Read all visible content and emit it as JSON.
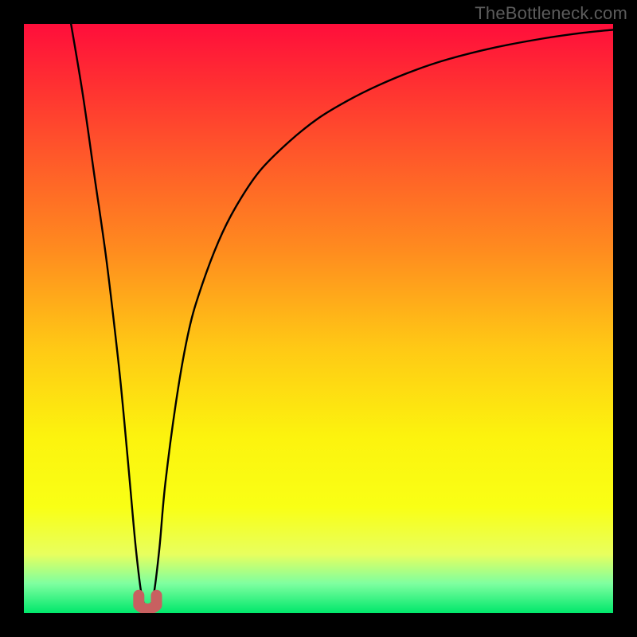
{
  "watermark": "TheBottleneck.com",
  "colors": {
    "frame": "#000000",
    "curve": "#000000",
    "marker_fill": "#c86060",
    "marker_stroke": "#c86060"
  },
  "chart_data": {
    "type": "line",
    "title": "",
    "xlabel": "",
    "ylabel": "",
    "xlim": [
      0,
      100
    ],
    "ylim": [
      0,
      100
    ],
    "grid": false,
    "series": [
      {
        "name": "curve",
        "x": [
          8,
          10,
          12,
          14,
          16,
          17,
          18,
          19,
          20,
          21,
          22,
          23,
          24,
          26,
          28,
          30,
          33,
          36,
          40,
          45,
          50,
          55,
          60,
          66,
          72,
          80,
          88,
          95,
          100
        ],
        "values": [
          100,
          88,
          74,
          60,
          43,
          33,
          22,
          11,
          3,
          1,
          3,
          11,
          22,
          37,
          48,
          55,
          63,
          69,
          75,
          80,
          84,
          87,
          89.5,
          92,
          94,
          96,
          97.5,
          98.5,
          99
        ]
      }
    ],
    "marker": {
      "x_range": [
        19.5,
        22.5
      ],
      "y_range": [
        0,
        3
      ],
      "shape": "u"
    },
    "background_gradient_stops": [
      {
        "pos": 0.0,
        "color": "#ff0e3b"
      },
      {
        "pos": 0.1,
        "color": "#ff2f32"
      },
      {
        "pos": 0.22,
        "color": "#ff572a"
      },
      {
        "pos": 0.38,
        "color": "#ff8a1f"
      },
      {
        "pos": 0.55,
        "color": "#ffc915"
      },
      {
        "pos": 0.7,
        "color": "#fcf30e"
      },
      {
        "pos": 0.82,
        "color": "#f9ff15"
      },
      {
        "pos": 0.9,
        "color": "#e8ff5e"
      },
      {
        "pos": 0.95,
        "color": "#7effa0"
      },
      {
        "pos": 1.0,
        "color": "#00e76b"
      }
    ]
  }
}
